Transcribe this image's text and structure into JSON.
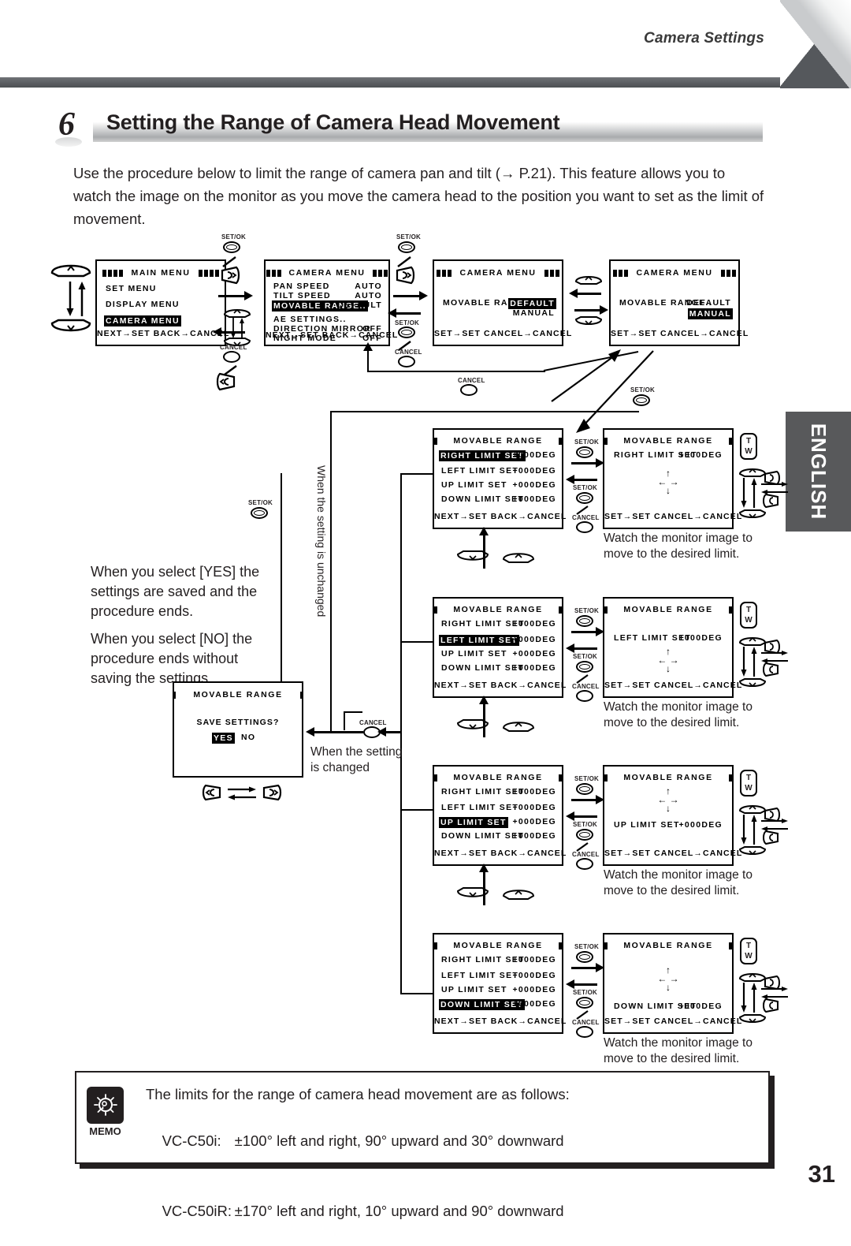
{
  "header": {
    "running_title": "Camera Settings",
    "side_tab": "ENGLISH",
    "page_number": "31"
  },
  "section": {
    "number": "6",
    "title": "Setting the Range of Camera Head Movement",
    "intro": "Use the procedure below to limit the range of camera pan and tilt (→ P.21). This feature allows you to watch the image on the monitor as you move the camera head to the position you want to set as the limit of movement."
  },
  "notes": {
    "yes_note": "When you select [YES] the settings are saved and the procedure ends.",
    "no_note": "When you select [NO] the procedure ends without saving the settings.",
    "unchanged": "When the setting is unchanged",
    "changed": "When the setting is changed",
    "watch": "Watch the monitor image to move to the desired limit."
  },
  "buttons": {
    "set_ok": "SET/OK",
    "cancel": "CANCEL",
    "tele": "T",
    "wide": "W"
  },
  "screens": {
    "main_menu": {
      "title": "MAIN  MENU",
      "rows": [
        {
          "label": "SET MENU",
          "value": "",
          "highlight": false
        },
        {
          "label": "DISPLAY MENU",
          "value": "",
          "highlight": false
        },
        {
          "label": "CAMERA MENU",
          "value": "",
          "highlight": true
        }
      ],
      "footer": "NEXT→SET  BACK→CANCEL"
    },
    "camera_menu": {
      "title": "CAMERA MENU",
      "rows": [
        {
          "label": "PAN  SPEED",
          "value": "AUTO",
          "highlight": false
        },
        {
          "label": "TILT SPEED",
          "value": "AUTO",
          "highlight": false
        },
        {
          "label": "MOVABLE RANGE..",
          "value": "DEFAULT",
          "highlight": true
        },
        {
          "label": "AE SETTINGS..",
          "value": "",
          "highlight": false
        },
        {
          "label": "DIRECTION MIRROR",
          "value": "OFF",
          "highlight": false
        },
        {
          "label": "NIGHT MODE",
          "value": "OFF",
          "highlight": false
        }
      ],
      "footer": "NEXT→SET  BACK→CANCEL"
    },
    "movable_default": {
      "title": "CAMERA MENU",
      "label": "MOVABLE RANGE..",
      "option_selected": "DEFAULT",
      "option_other": "MANUAL",
      "footer": "SET→SET CANCEL→CANCEL"
    },
    "movable_manual": {
      "title": "CAMERA MENU",
      "label": "MOVABLE RANGE..",
      "option_selected": "MANUAL",
      "option_other": "DEFAULT",
      "footer": "SET→SET CANCEL→CANCEL"
    },
    "limit_list": {
      "title": "MOVABLE RANGE",
      "footer": "NEXT→SET  BACK→CANCEL",
      "rows": [
        {
          "label": "RIGHT LIMIT SET",
          "value": "+000DEG"
        },
        {
          "label": "LEFT LIMIT SET",
          "value": "+000DEG"
        },
        {
          "label": "UP LIMIT SET",
          "value": "+000DEG"
        },
        {
          "label": "DOWN LIMIT SET",
          "value": "+000DEG"
        }
      ]
    },
    "limit_detail": {
      "title": "MOVABLE RANGE",
      "footer": "SET→SET CANCEL→CANCEL",
      "items": [
        {
          "label": "RIGHT LIMIT SET",
          "value": "+000DEG"
        },
        {
          "label": "LEFT LIMIT SET",
          "value": "+000DEG"
        },
        {
          "label": "UP LIMIT SET",
          "value": "+000DEG"
        },
        {
          "label": "DOWN LIMIT SET",
          "value": "+000DEG"
        }
      ]
    },
    "save_settings": {
      "title": "MOVABLE RANGE",
      "prompt": "SAVE SETTINGS?",
      "yes": "YES",
      "no": "NO"
    }
  },
  "memo": {
    "label": "MEMO",
    "intro": "The limits for the range of camera head movement are as follows:",
    "rows": [
      {
        "model": "VC-C50i:",
        "text": "±100° left and right, 90° upward and 30° downward"
      },
      {
        "model": "VC-C50iR:",
        "text": "±170° left and right, 10° upward and 90° downward"
      }
    ]
  }
}
